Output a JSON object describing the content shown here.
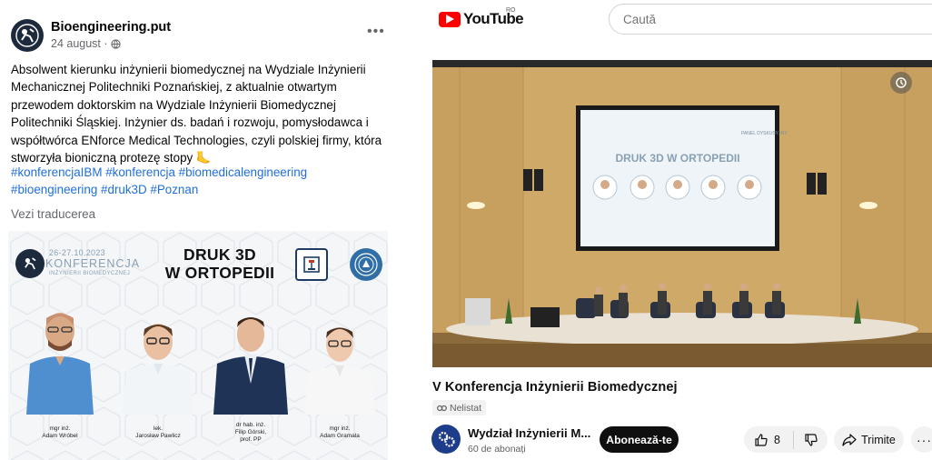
{
  "facebook": {
    "page_name": "Bioengineering.put",
    "date": "24 august ·",
    "post_text": "Absolwent kierunku inżynierii biomedycznej na Wydziale Inżynierii Mechanicznej Politechniki Poznańskiej, z aktualnie otwartym przewodem doktorskim na Wydziale Inżynierii Biomedycznej Politechniki Śląskiej. Inżynier ds. badań i rozwoju, pomysłodawca i współtwórca ENforce Medical Technologies, czyli polskiej firmy, która stworzyła bioniczną protezę stopy 🦶",
    "hashtags": [
      "#konferencjaIBM",
      "#konferencja",
      "#biomedicalengineering",
      "#bioengineering",
      "#druk3D",
      "#Poznan"
    ],
    "see_translation": "Vezi traducerea",
    "promo": {
      "dates": "26-27.10.2023",
      "conference": "KONFERENCJA",
      "conference_sub": "INŻYNIERII BIOMEDYCZNEJ",
      "title_line1": "DRUK 3D",
      "title_line2": "W ORTOPEDII",
      "speakers": [
        {
          "title": "mgr inż.",
          "name": "Adam Wróbel"
        },
        {
          "title": "lek.",
          "name": "Jarosław Pawlicz"
        },
        {
          "title": "dr hab. inż.",
          "name": "Filip Górski,",
          "extra": "prof. PP"
        },
        {
          "title": "mgr inż.",
          "name": "Adam Gramala"
        }
      ]
    }
  },
  "youtube": {
    "logo_text": "YouTube",
    "region": "RO",
    "search_placeholder": "Caută",
    "video_title": "V Konferencja Inżynierii Biomedycznej",
    "visibility": "Nelistat",
    "channel_name": "Wydział Inżynierii M...",
    "subscribers": "60 de abonați",
    "subscribe_label": "Abonează-te",
    "likes": "8",
    "share_label": "Trimite",
    "screen": {
      "header": "PANEL DYSKUSYJNY",
      "title": "DRUK 3D W ORTOPEDII"
    }
  },
  "colors": {
    "fb_link": "#216fdb",
    "yt_red": "#ff0000",
    "stage_wall": "#c9a96a"
  }
}
